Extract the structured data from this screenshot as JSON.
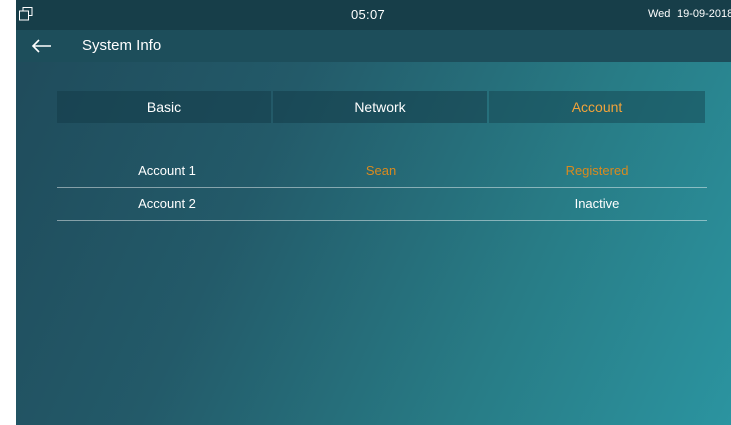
{
  "status_bar": {
    "time": "05:07",
    "day": "Wed",
    "date": "19-09-2018",
    "window_icon": "window-icon"
  },
  "header": {
    "back_icon": "arrow-left-icon",
    "title": "System Info"
  },
  "tabs": [
    {
      "label": "Basic",
      "active": false
    },
    {
      "label": "Network",
      "active": false
    },
    {
      "label": "Account",
      "active": true
    }
  ],
  "accounts": [
    {
      "name": "Account 1",
      "user": "Sean",
      "status": "Registered"
    },
    {
      "name": "Account 2",
      "user": "",
      "status": "Inactive"
    }
  ],
  "colors": {
    "accent": "#f2a33a",
    "registered": "#d98a1e",
    "status_bar": "#173e49"
  }
}
